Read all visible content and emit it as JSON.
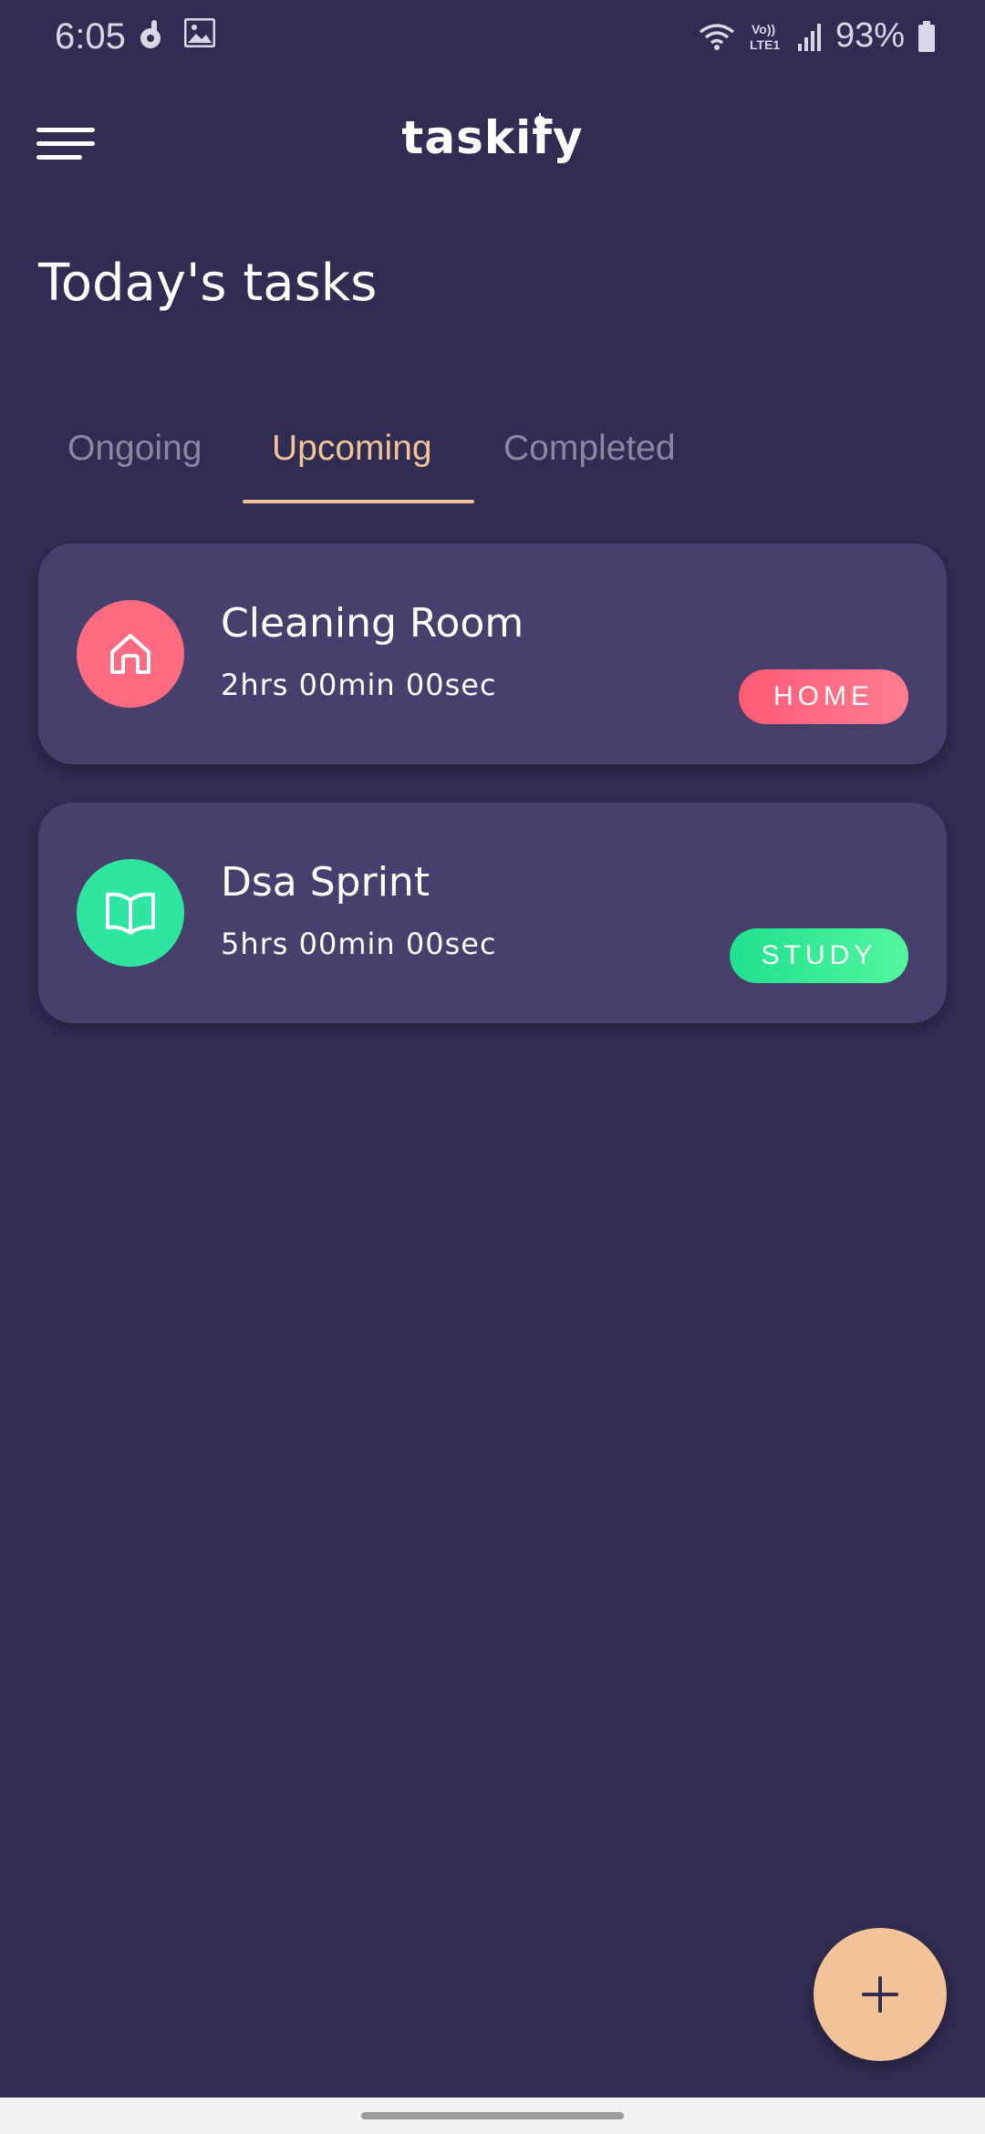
{
  "status_bar": {
    "time": "6:05",
    "battery": "93%",
    "icons": [
      "ok-hand-icon",
      "gallery-icon",
      "wifi-icon",
      "volte-icon",
      "signal-icon",
      "battery-icon"
    ],
    "volte_label": "Vo)) LTE1"
  },
  "app_bar": {
    "logo": "taskify",
    "menu_icon": "hamburger-menu-icon"
  },
  "page": {
    "title": "Today's tasks"
  },
  "tabs": [
    {
      "label": "Ongoing",
      "active": false
    },
    {
      "label": "Upcoming",
      "active": true
    },
    {
      "label": "Completed",
      "active": false
    }
  ],
  "tasks": [
    {
      "title": "Cleaning Room",
      "duration": "2hrs 00min 00sec",
      "tag": "HOME",
      "icon": "home-icon",
      "icon_bg": "#fe6b80",
      "tag_colors": [
        "#fe5b76",
        "#ff7d90"
      ]
    },
    {
      "title": "Dsa Sprint",
      "duration": "5hrs 00min 00sec",
      "tag": "STUDY",
      "icon": "open-book-icon",
      "icon_bg": "#2fe6a0",
      "tag_colors": [
        "#20e08e",
        "#52f79e"
      ]
    }
  ],
  "fab": {
    "icon": "plus-icon"
  },
  "colors": {
    "background": "#312c51",
    "card": "#47406d",
    "accent": "#f2c398",
    "inactive_tab": "#8a87a3"
  }
}
